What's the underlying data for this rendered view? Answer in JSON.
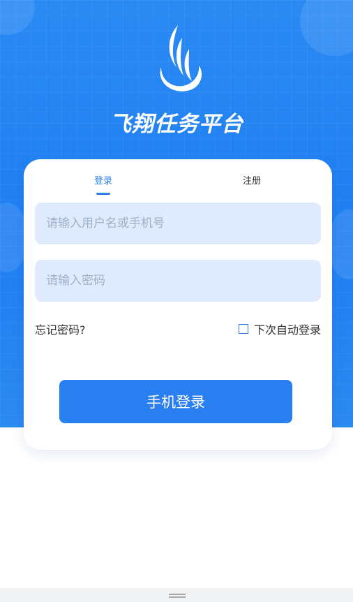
{
  "app": {
    "title": "飞翔任务平台"
  },
  "tabs": {
    "login": "登录",
    "register": "注册"
  },
  "form": {
    "username_placeholder": "请输入用户名或手机号",
    "password_placeholder": "请输入密码",
    "forgot_password": "忘记密码?",
    "remember_label": "下次自动登录",
    "remember_checked": false,
    "submit_label": "手机登录"
  },
  "colors": {
    "brand_blue": "#2a7ff0",
    "field_bg": "#dfebfc"
  },
  "icons": {
    "logo": "wing-logo-icon",
    "bottom_handle": "drag-handle-icon"
  }
}
